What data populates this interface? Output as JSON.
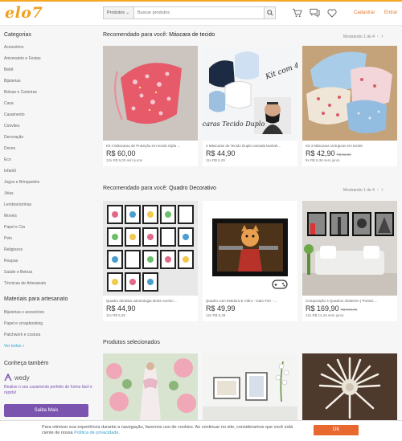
{
  "header": {
    "logo": "elo7",
    "search_category": "Produtos",
    "search_placeholder": "Buscar produtos",
    "cadastrar": "Cadastrar",
    "entrar": "Entrar"
  },
  "sidebar": {
    "categories_title": "Categorias",
    "categories": [
      "Acessórios",
      "Aniversário e Festas",
      "Bebê",
      "Bijuterias",
      "Bolsas e Carteiras",
      "Casa",
      "Casamento",
      "Convites",
      "Decoração",
      "Doces",
      "Eco",
      "Infantil",
      "Jogos e Brinquedos",
      "Jóias",
      "Lembrancinhas",
      "Moveis",
      "Papel e Cia",
      "Pets",
      "Religiosos",
      "Roupas",
      "Saúde e Beleza",
      "Técnicas de Artesanato"
    ],
    "materials_title": "Materiais para artesanato",
    "materials": [
      "Bijuterias e acessórios",
      "Papel e scrapbooking",
      "Patchwork e costura"
    ],
    "see_all": "Ver todos »",
    "also_title": "Conheça também",
    "wedy_name": "wedy",
    "wedy_text": "Realize o seu casamento perfeito de forma fácil e rápida!",
    "saiba_mais": "Saiba Mais"
  },
  "sections": [
    {
      "prefix": "Recomendado para você: ",
      "topic": "Máscara de tecido",
      "pager": "Mostrando 1 de 4",
      "cards": [
        {
          "name": "Kit 4 Máscaras de Proteção em tecido tripla ...",
          "price": "R$ 60,00",
          "old": "",
          "installments": "12x R$ 5,00 sem juros"
        },
        {
          "name": "4 Máscaras de Tecido Dupla camada lavável...",
          "price": "R$ 44,90",
          "old": "",
          "installments": "11x R$ 5,25"
        },
        {
          "name": "Kit 4 Máscaras cirúrgicas em tecido",
          "price": "R$ 42,90",
          "old": "R$ 52,50",
          "installments": "8x R$ 5,36 sem juros"
        }
      ]
    },
    {
      "prefix": "Recomendado para você: ",
      "topic": "Quadro Decorativo",
      "pager": "Mostrando 1 de 4",
      "cards": [
        {
          "name": "Quadro dentista odontologia dente sorriso ...",
          "price": "R$ 44,90",
          "old": "",
          "installments": "11x R$ 5,25"
        },
        {
          "name": "Quadro com Moldura E Vidro - Gato #10 - ...",
          "price": "R$ 49,99",
          "old": "",
          "installments": "12x R$ 5,48"
        },
        {
          "name": "Composição 4 Quadros 40x50cm | Pontos ...",
          "price": "R$ 169,90",
          "old": "R$ 199,90",
          "installments": "12x R$ 14,16 sem juros"
        }
      ]
    },
    {
      "title": "Produtos selecionados"
    }
  ],
  "kit_text": "Kit com 4",
  "mask_caption": "Máscaras Tecido Duplo",
  "cookie": {
    "text": "Para otimizar sua experiência durante a navegação, fazemos uso de cookies. Ao continuar no site, consideramos que você está ciente de nossa ",
    "link": "Política de privacidade",
    "ok": "OK"
  },
  "colors": {
    "brand": "#f0a020",
    "accent": "#e8682f",
    "link": "#3a9ec9",
    "wedy": "#7b54b0"
  }
}
